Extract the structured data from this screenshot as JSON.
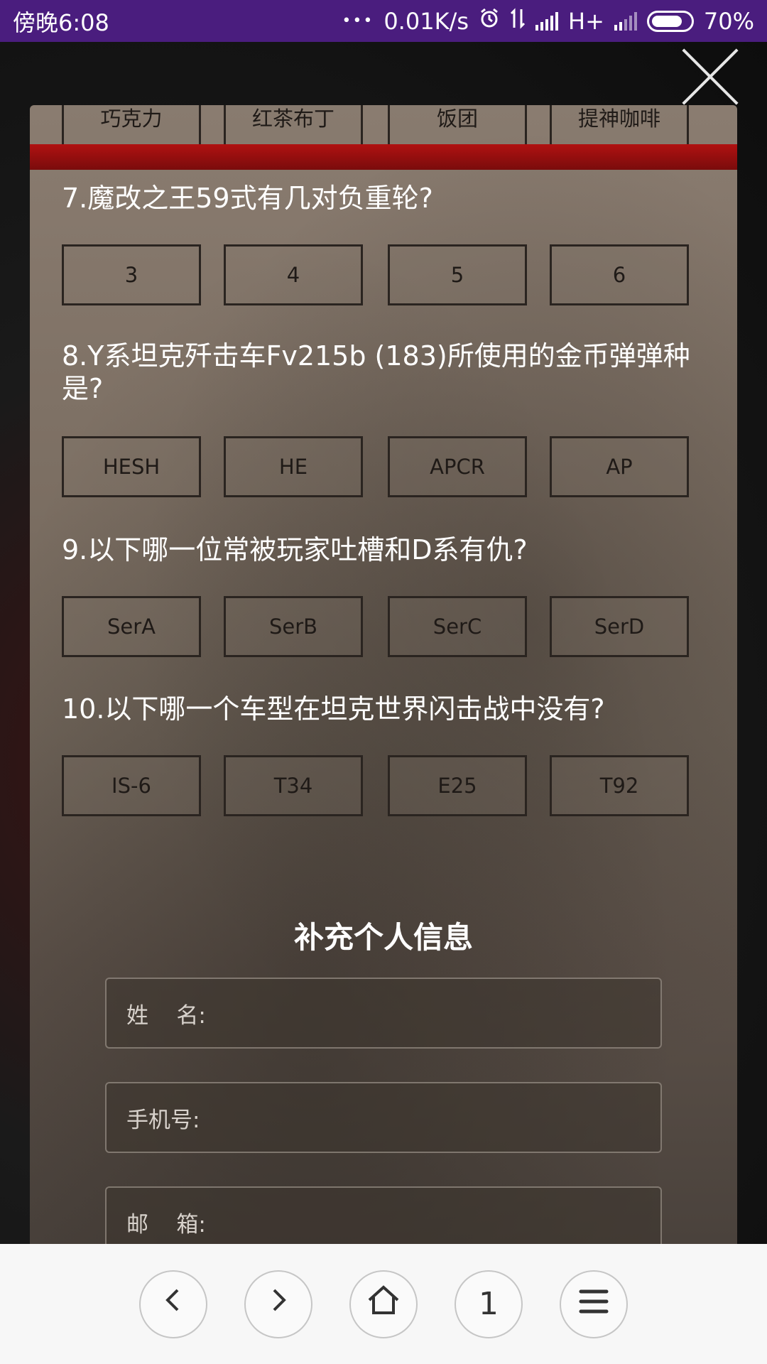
{
  "status_bar": {
    "time": "傍晚6:08",
    "dots": "•••",
    "network_speed": "0.01K/s",
    "network_type": "H+",
    "battery": "70%"
  },
  "quiz": {
    "prev_options": [
      "巧克力",
      "红茶布丁",
      "饭团",
      "提神咖啡"
    ],
    "questions": [
      {
        "text": "7.魔改之王59式有几对负重轮?",
        "options": [
          "3",
          "4",
          "5",
          "6"
        ]
      },
      {
        "text": "8.Y系坦克歼击车Fv215b (183)所使用的金币弹弹种是?",
        "options": [
          "HESH",
          "HE",
          "APCR",
          "AP"
        ]
      },
      {
        "text": "9.以下哪一位常被玩家吐槽和D系有仇?",
        "options": [
          "SerA",
          "SerB",
          "SerC",
          "SerD"
        ]
      },
      {
        "text": "10.以下哪一个车型在坦克世界闪击战中没有?",
        "options": [
          "IS-6",
          "T34",
          "E25",
          "T92"
        ]
      }
    ]
  },
  "personal_info": {
    "title": "补充个人信息",
    "name_label": "姓    名:",
    "phone_label": "手机号:",
    "email_label": "邮    箱:"
  },
  "nav": {
    "back_icon": "chevron-left-icon",
    "forward_icon": "chevron-right-icon",
    "home_icon": "home-icon",
    "tabs_count": "1",
    "menu_icon": "menu-icon"
  },
  "colors": {
    "status_bar": "#4a1d7e",
    "accent_red": "#b01111"
  }
}
